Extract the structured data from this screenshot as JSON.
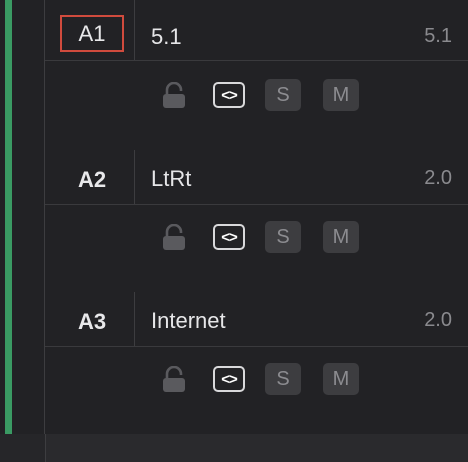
{
  "tracks": [
    {
      "id": "A1",
      "name": "5.1",
      "format": "5.1",
      "selected": true
    },
    {
      "id": "A2",
      "name": "LtRt",
      "format": "2.0",
      "selected": false
    },
    {
      "id": "A3",
      "name": "Internet",
      "format": "2.0",
      "selected": false
    }
  ],
  "controls": {
    "code_label": "<>",
    "solo_label": "S",
    "mute_label": "M"
  },
  "colors": {
    "track_color": "#3a9a63",
    "selection_border": "#d14b3d"
  },
  "icons": {
    "lock": "lock-icon",
    "link": "code-icon"
  }
}
